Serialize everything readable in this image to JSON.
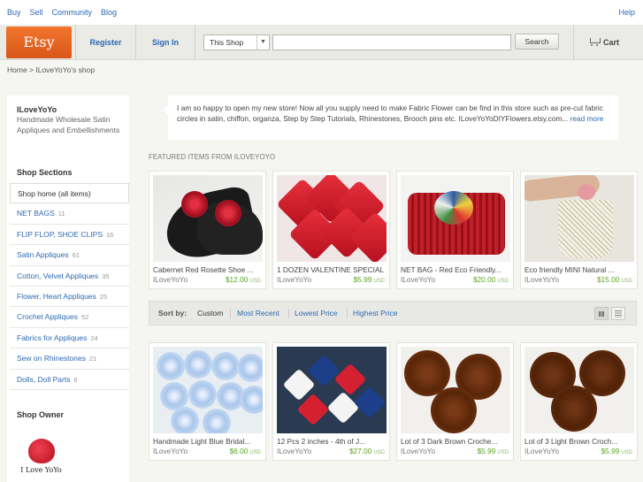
{
  "topnav": {
    "buy": "Buy",
    "sell": "Sell",
    "community": "Community",
    "blog": "Blog",
    "help": "Help"
  },
  "header": {
    "logo": "Etsy",
    "register": "Register",
    "sign_in": "Sign In",
    "scope_select": "This Shop",
    "search_value": "",
    "search_button": "Search",
    "cart": "Cart"
  },
  "breadcrumb": "Home > ILoveYoYo's shop",
  "sidebar": {
    "shop_name": "ILoveYoYo",
    "tagline": "Handmade Wholesale Satin Appliques and Embellishments",
    "sections_title": "Shop Sections",
    "sections": [
      {
        "label": "Shop home (all items)",
        "count": ""
      },
      {
        "label": "NET BAGS",
        "count": "11"
      },
      {
        "label": "FLIP FLOP, SHOE CLIPS",
        "count": "16"
      },
      {
        "label": "Satin Appliques",
        "count": "61"
      },
      {
        "label": "Cotton, Velvet Appliques",
        "count": "35"
      },
      {
        "label": "Flower, Heart Appliques",
        "count": "25"
      },
      {
        "label": "Crochet Appliques",
        "count": "52"
      },
      {
        "label": "Fabrics for Appliques",
        "count": "24"
      },
      {
        "label": "Sew on Rhinestones",
        "count": "21"
      },
      {
        "label": "Dolls, Doll Parts",
        "count": "6"
      }
    ],
    "owner_title": "Shop Owner",
    "owner_caption": "I Love YoYo"
  },
  "announcement": {
    "text": "I am so happy to open my new store! Now all you supply need to make Fabric Flower can be find in this store such as pre-cut fabric circles in satin, chiffon, organza, Step by Step Tutorials, Rhinestones, Brooch pins etc. ILoveYoYoDIYFlowers.etsy.com...",
    "more": "read more"
  },
  "featured_title": "FEATURED ITEMS FROM ILOVEYOYO",
  "featured": [
    {
      "title": "Cabernet Red Rosette Shoe ...",
      "seller": "ILoveYoYo",
      "price": "$12.00",
      "currency": "USD"
    },
    {
      "title": "1 DOZEN VALENTINE SPECIAL ...",
      "seller": "ILoveYoYo",
      "price": "$5.99",
      "currency": "USD"
    },
    {
      "title": "NET BAG - Red Eco Friendly...",
      "seller": "ILoveYoYo",
      "price": "$20.00",
      "currency": "USD"
    },
    {
      "title": "Eco friendly MINI Natural ...",
      "seller": "ILoveYoYo",
      "price": "$15.00",
      "currency": "USD"
    }
  ],
  "sort": {
    "label": "Sort by:",
    "options": [
      "Custom",
      "Most Recent",
      "Lowest Price",
      "Highest Price"
    ],
    "selected": "Custom"
  },
  "items": [
    {
      "title": "Handmade Light Blue Bridal...",
      "seller": "ILoveYoYo",
      "price": "$6.00",
      "currency": "USD"
    },
    {
      "title": "12 Pcs 2 inches - 4th of J...",
      "seller": "ILoveYoYo",
      "price": "$27.00",
      "currency": "USD"
    },
    {
      "title": "Lot of 3 Dark Brown Croche...",
      "seller": "ILoveYoYo",
      "price": "$5.99",
      "currency": "USD"
    },
    {
      "title": "Lot of 3 Light Brown Croch...",
      "seller": "ILoveYoYo",
      "price": "$5.99",
      "currency": "USD"
    }
  ],
  "colors": {
    "brand_orange": "#e5661f",
    "link_blue": "#2e6ab1",
    "price_green": "#5da423"
  }
}
